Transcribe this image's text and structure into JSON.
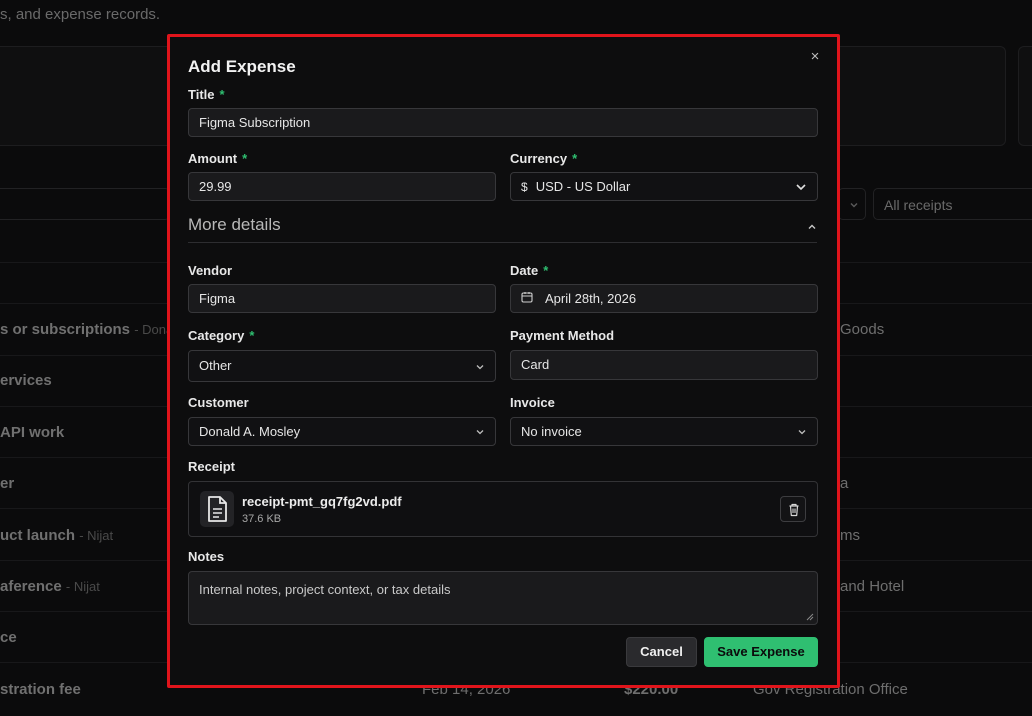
{
  "background": {
    "subtitle": "s, and expense records.",
    "filter_receipts": "All receipts",
    "rows_left": [
      {
        "title": "s or subscriptions",
        "by": "- Dona"
      },
      {
        "title": "ervices",
        "by": ""
      },
      {
        "title": "API work",
        "by": ""
      },
      {
        "title": "er",
        "by": ""
      },
      {
        "title": "uct launch",
        "by": "- Nijat"
      },
      {
        "title": "aference",
        "by": "- Nijat"
      },
      {
        "title": "ce",
        "by": ""
      },
      {
        "title": "stration fee",
        "by": ""
      }
    ],
    "rows_right": [
      "Goods",
      "",
      "",
      "a",
      "ms",
      "and Hotel",
      "",
      "Gov Registration Office"
    ],
    "last_row_date": "Feb 14, 2026",
    "last_row_amount": "$220.00"
  },
  "modal": {
    "title": "Add Expense",
    "close_glyph": "×",
    "title_field": {
      "label": "Title",
      "required": "*",
      "value": "Figma Subscription"
    },
    "amount": {
      "label": "Amount",
      "required": "*",
      "value": "29.99"
    },
    "currency": {
      "label": "Currency",
      "required": "*",
      "symbol": "$",
      "value": "USD - US Dollar"
    },
    "more_details": "More details",
    "vendor": {
      "label": "Vendor",
      "value": "Figma"
    },
    "date": {
      "label": "Date",
      "required": "*",
      "value": "April 28th, 2026"
    },
    "category": {
      "label": "Category",
      "required": "*",
      "value": "Other"
    },
    "payment_method": {
      "label": "Payment Method",
      "value": "Card"
    },
    "customer": {
      "label": "Customer",
      "value": "Donald A. Mosley"
    },
    "invoice": {
      "label": "Invoice",
      "value": "No invoice"
    },
    "receipt": {
      "label": "Receipt",
      "file_name": "receipt-pmt_gq7fg2vd.pdf",
      "file_size": "37.6 KB"
    },
    "notes": {
      "label": "Notes",
      "placeholder": "Internal notes, project context, or tax details"
    },
    "cancel_label": "Cancel",
    "save_label": "Save Expense"
  },
  "colors": {
    "accent": "#2fbf71",
    "highlight_border": "#e0141b",
    "modal_bg": "#0d0d0e"
  }
}
